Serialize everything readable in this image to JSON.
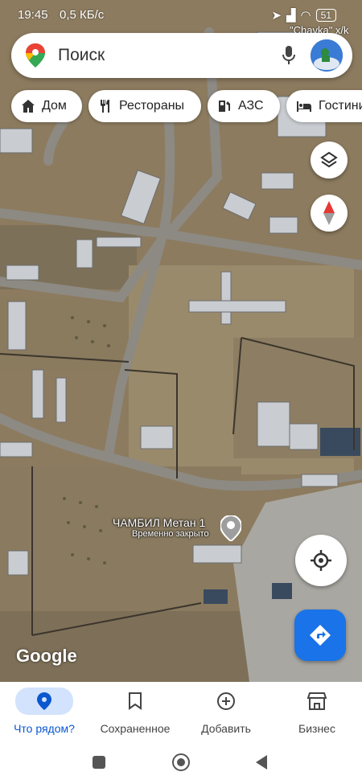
{
  "status_bar": {
    "time": "19:45",
    "speed": "0,5 КБ/с",
    "battery": "51"
  },
  "search": {
    "placeholder": "Поиск"
  },
  "map_labels": {
    "top_right": "\"Chavka\" x/k"
  },
  "chips": [
    {
      "label": "Дом",
      "icon": "home-icon"
    },
    {
      "label": "Рестораны",
      "icon": "restaurant-icon"
    },
    {
      "label": "АЗС",
      "icon": "gas-station-icon"
    },
    {
      "label": "Гостини",
      "icon": "hotel-icon"
    }
  ],
  "poi": {
    "name": "ЧАМБИЛ Метан 1",
    "status": "Временно закрыто"
  },
  "brand": {
    "logo": "Google"
  },
  "bottom_nav": [
    {
      "label": "Что рядом?",
      "icon": "explore-pin-icon",
      "active": true
    },
    {
      "label": "Сохраненное",
      "icon": "bookmark-icon"
    },
    {
      "label": "Добавить",
      "icon": "add-circle-icon"
    },
    {
      "label": "Бизнес",
      "icon": "store-icon"
    }
  ],
  "colors": {
    "accent": "#1a73e8",
    "active_nav_bg": "#d3e3fd"
  }
}
